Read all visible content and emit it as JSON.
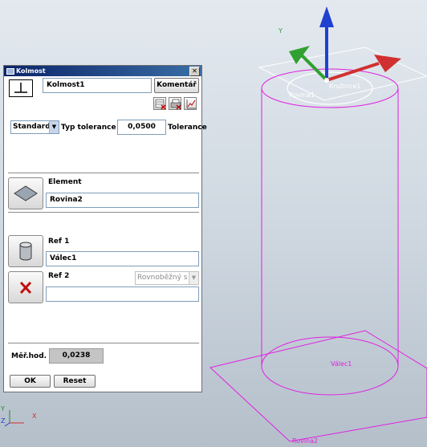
{
  "dialog": {
    "title": "Kolmost",
    "close_label": "✕",
    "name_value": "Kolmost1",
    "comment_button": "Komentář",
    "tolerance_type_selected": "Standard",
    "tolerance_type_label": "Typ tolerance",
    "tolerance_value": "0,0500",
    "tolerance_label": "Tolerance",
    "element_label": "Element",
    "element_value": "Rovina2",
    "ref1_label": "Ref 1",
    "ref1_value": "Válec1",
    "ref2_label": "Ref 2",
    "ref2_mode": "Rovnoběžný s",
    "ref2_value": "",
    "measured_label": "Měř.hod.",
    "measured_value": "0,0238",
    "ok_button": "OK",
    "reset_button": "Reset"
  },
  "viewport": {
    "labels": {
      "axis_y": "Y",
      "plane_top": "Rovina1",
      "circle_top": "Kružnice1",
      "cylinder": "Válec1",
      "plane_bottom": "Rovina2",
      "triad_y": "Y",
      "triad_x": "X",
      "triad_z": "Z"
    },
    "colors": {
      "geometry": "#e020e0",
      "axis_x": "#d03030",
      "axis_y": "#30a030",
      "axis_z": "#2040d0",
      "label_white": "#ffffff"
    }
  },
  "icons": {
    "perpendicularity": "perpendicularity-icon",
    "plane": "plane-icon",
    "cylinder": "cylinder-icon",
    "delete": "delete-x-icon"
  }
}
